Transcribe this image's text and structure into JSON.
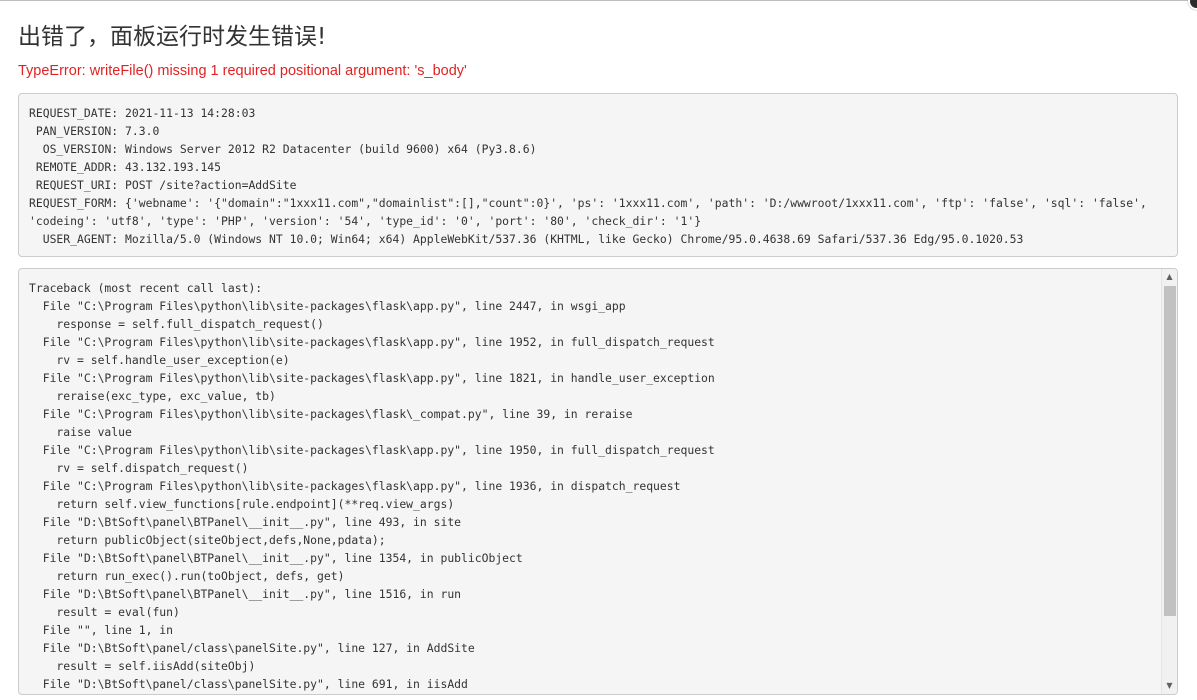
{
  "error_title": "出错了，面板运行时发生错误!",
  "error_message": "TypeError: writeFile() missing 1 required positional argument: 's_body'",
  "request_info": "REQUEST_DATE: 2021-11-13 14:28:03\n PAN_VERSION: 7.3.0\n  OS_VERSION: Windows Server 2012 R2 Datacenter (build 9600) x64 (Py3.8.6)\n REMOTE_ADDR: 43.132.193.145\n REQUEST_URI: POST /site?action=AddSite\nREQUEST_FORM: {'webname': '{\"domain\":\"1xxx11.com\",\"domainlist\":[],\"count\":0}', 'ps': '1xxx11.com', 'path': 'D:/wwwroot/1xxx11.com', 'ftp': 'false', 'sql': 'false', 'codeing': 'utf8', 'type': 'PHP', 'version': '54', 'type_id': '0', 'port': '80', 'check_dir': '1'}\n  USER_AGENT: Mozilla/5.0 (Windows NT 10.0; Win64; x64) AppleWebKit/537.36 (KHTML, like Gecko) Chrome/95.0.4638.69 Safari/537.36 Edg/95.0.1020.53",
  "traceback": [
    "Traceback (most recent call last):",
    "  File \"C:\\Program Files\\python\\lib\\site-packages\\flask\\app.py\", line 2447, in wsgi_app",
    "    response = self.full_dispatch_request()",
    "  File \"C:\\Program Files\\python\\lib\\site-packages\\flask\\app.py\", line 1952, in full_dispatch_request",
    "    rv = self.handle_user_exception(e)",
    "  File \"C:\\Program Files\\python\\lib\\site-packages\\flask\\app.py\", line 1821, in handle_user_exception",
    "    reraise(exc_type, exc_value, tb)",
    "  File \"C:\\Program Files\\python\\lib\\site-packages\\flask\\_compat.py\", line 39, in reraise",
    "    raise value",
    "  File \"C:\\Program Files\\python\\lib\\site-packages\\flask\\app.py\", line 1950, in full_dispatch_request",
    "    rv = self.dispatch_request()",
    "  File \"C:\\Program Files\\python\\lib\\site-packages\\flask\\app.py\", line 1936, in dispatch_request",
    "    return self.view_functions[rule.endpoint](**req.view_args)",
    "  File \"D:\\BtSoft\\panel\\BTPanel\\__init__.py\", line 493, in site",
    "    return publicObject(siteObject,defs,None,pdata);",
    "  File \"D:\\BtSoft\\panel\\BTPanel\\__init__.py\", line 1354, in publicObject",
    "    return run_exec().run(toObject, defs, get)",
    "  File \"D:\\BtSoft\\panel\\BTPanel\\__init__.py\", line 1516, in run",
    "    result = eval(fun)",
    "  File \"\", line 1, in",
    "  File \"D:\\BtSoft\\panel/class\\panelSite.py\", line 127, in AddSite",
    "    result = self.iisAdd(siteObj)",
    "  File \"D:\\BtSoft\\panel/class\\panelSite.py\", line 691, in iisAdd"
  ],
  "scrollbar": {
    "up_arrow": "▲",
    "down_arrow": "▼"
  },
  "colors": {
    "error_message": "#e22222",
    "title": "#333333",
    "box_background": "#f5f5f5",
    "box_border": "#cccccc"
  },
  "icons": {
    "close": "close-icon"
  }
}
